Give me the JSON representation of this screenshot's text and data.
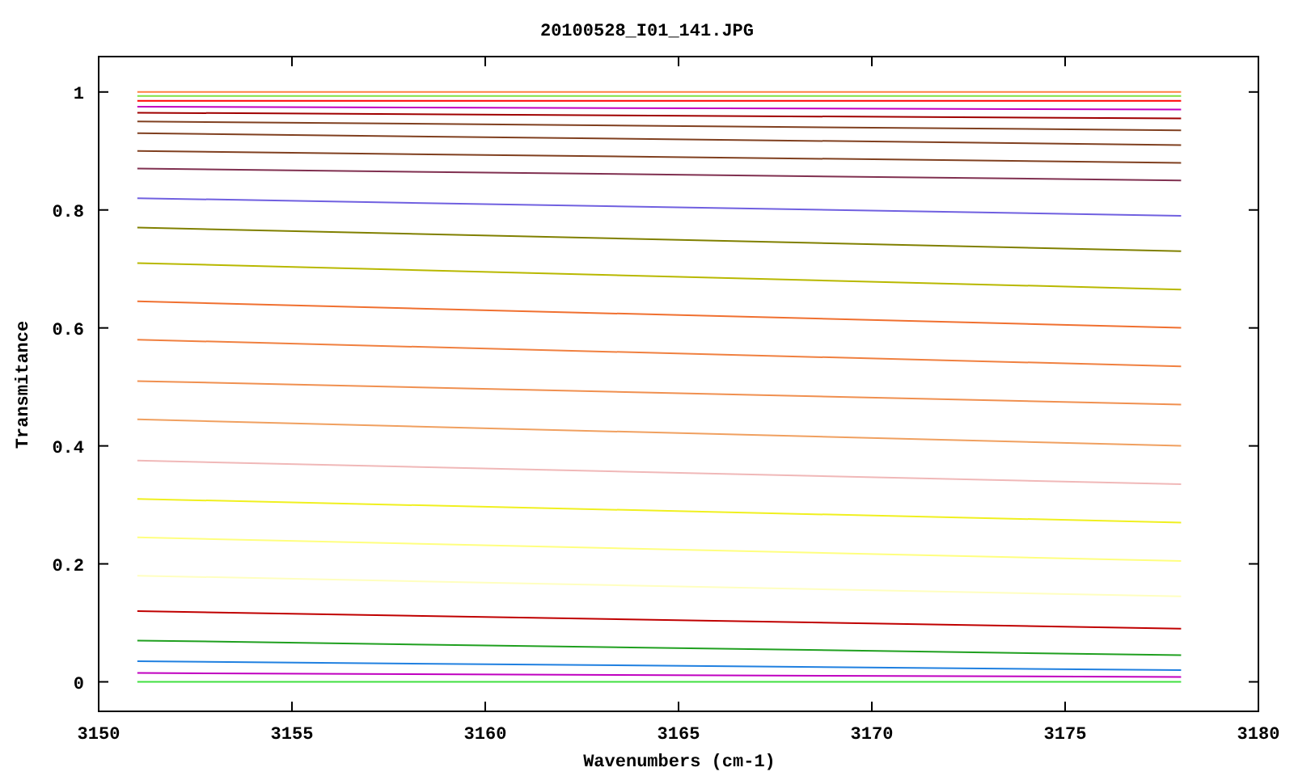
{
  "chart_data": {
    "type": "line",
    "title": "20100528_I01_141.JPG",
    "xlabel": "Wavenumbers (cm-1)",
    "ylabel": "Transmitance",
    "x": [
      3151,
      3178
    ],
    "xlim": [
      3150,
      3180
    ],
    "ylim": [
      -0.05,
      1.06
    ],
    "xticks": [
      3150,
      3155,
      3160,
      3165,
      3170,
      3175,
      3180
    ],
    "yticks": [
      0,
      0.2,
      0.4,
      0.6,
      0.8,
      1
    ],
    "series": [
      {
        "color": "#ff8040",
        "values": [
          1.0,
          1.0
        ]
      },
      {
        "color": "#80e040",
        "values": [
          0.993,
          0.993
        ]
      },
      {
        "color": "#ff0000",
        "values": [
          0.985,
          0.985
        ]
      },
      {
        "color": "#c000c0",
        "values": [
          0.975,
          0.97
        ]
      },
      {
        "color": "#a00000",
        "values": [
          0.965,
          0.955
        ]
      },
      {
        "color": "#804020",
        "values": [
          0.95,
          0.935
        ]
      },
      {
        "color": "#804020",
        "values": [
          0.93,
          0.91
        ]
      },
      {
        "color": "#804020",
        "values": [
          0.9,
          0.88
        ]
      },
      {
        "color": "#803050",
        "values": [
          0.87,
          0.85
        ]
      },
      {
        "color": "#7060e0",
        "values": [
          0.82,
          0.79
        ]
      },
      {
        "color": "#808000",
        "values": [
          0.77,
          0.73
        ]
      },
      {
        "color": "#b8b800",
        "values": [
          0.71,
          0.665
        ]
      },
      {
        "color": "#f07030",
        "values": [
          0.645,
          0.6
        ]
      },
      {
        "color": "#f08040",
        "values": [
          0.58,
          0.535
        ]
      },
      {
        "color": "#f09050",
        "values": [
          0.51,
          0.47
        ]
      },
      {
        "color": "#f0a060",
        "values": [
          0.445,
          0.4
        ]
      },
      {
        "color": "#f0b8b8",
        "values": [
          0.375,
          0.335
        ]
      },
      {
        "color": "#f0f020",
        "values": [
          0.31,
          0.27
        ]
      },
      {
        "color": "#ffff80",
        "values": [
          0.245,
          0.205
        ]
      },
      {
        "color": "#ffffc0",
        "values": [
          0.18,
          0.145
        ]
      },
      {
        "color": "#c00000",
        "values": [
          0.12,
          0.09
        ]
      },
      {
        "color": "#20a020",
        "values": [
          0.07,
          0.045
        ]
      },
      {
        "color": "#2080e0",
        "values": [
          0.035,
          0.02
        ]
      },
      {
        "color": "#c000c0",
        "values": [
          0.015,
          0.008
        ]
      },
      {
        "color": "#40e040",
        "values": [
          0.0,
          0.0
        ]
      }
    ]
  }
}
